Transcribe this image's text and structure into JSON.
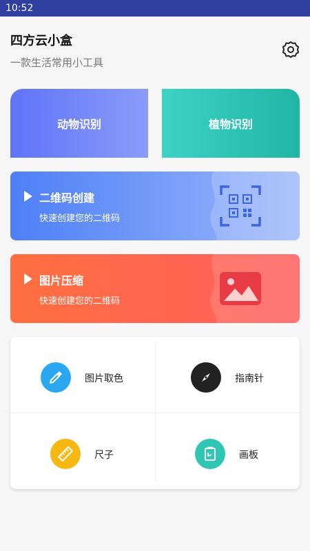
{
  "status": {
    "time": "10:52"
  },
  "header": {
    "title": "四方云小盒",
    "subtitle": "一款生活常用小工具"
  },
  "cards": {
    "animal": "动物识别",
    "plant": "植物识别"
  },
  "banners": [
    {
      "title": "二维码创建",
      "subtitle": "快速创建您的二维码"
    },
    {
      "title": "图片压缩",
      "subtitle": "快速创建您的二维码"
    }
  ],
  "tools": [
    {
      "label": "图片取色",
      "icon": "eyedropper-icon",
      "color": "#2aa7f0"
    },
    {
      "label": "指南针",
      "icon": "compass-icon",
      "color": "#222222"
    },
    {
      "label": "尺子",
      "icon": "ruler-icon",
      "color": "#f7b813"
    },
    {
      "label": "画板",
      "icon": "drawing-board-icon",
      "color": "#2fc7b4"
    }
  ],
  "colors": {
    "status_bar": "#303f9f",
    "animal_card": "#5f74f8",
    "plant_card": "#1fb6a6",
    "qr_banner": "#4d7ff7",
    "image_banner": "#ff6f3f"
  }
}
